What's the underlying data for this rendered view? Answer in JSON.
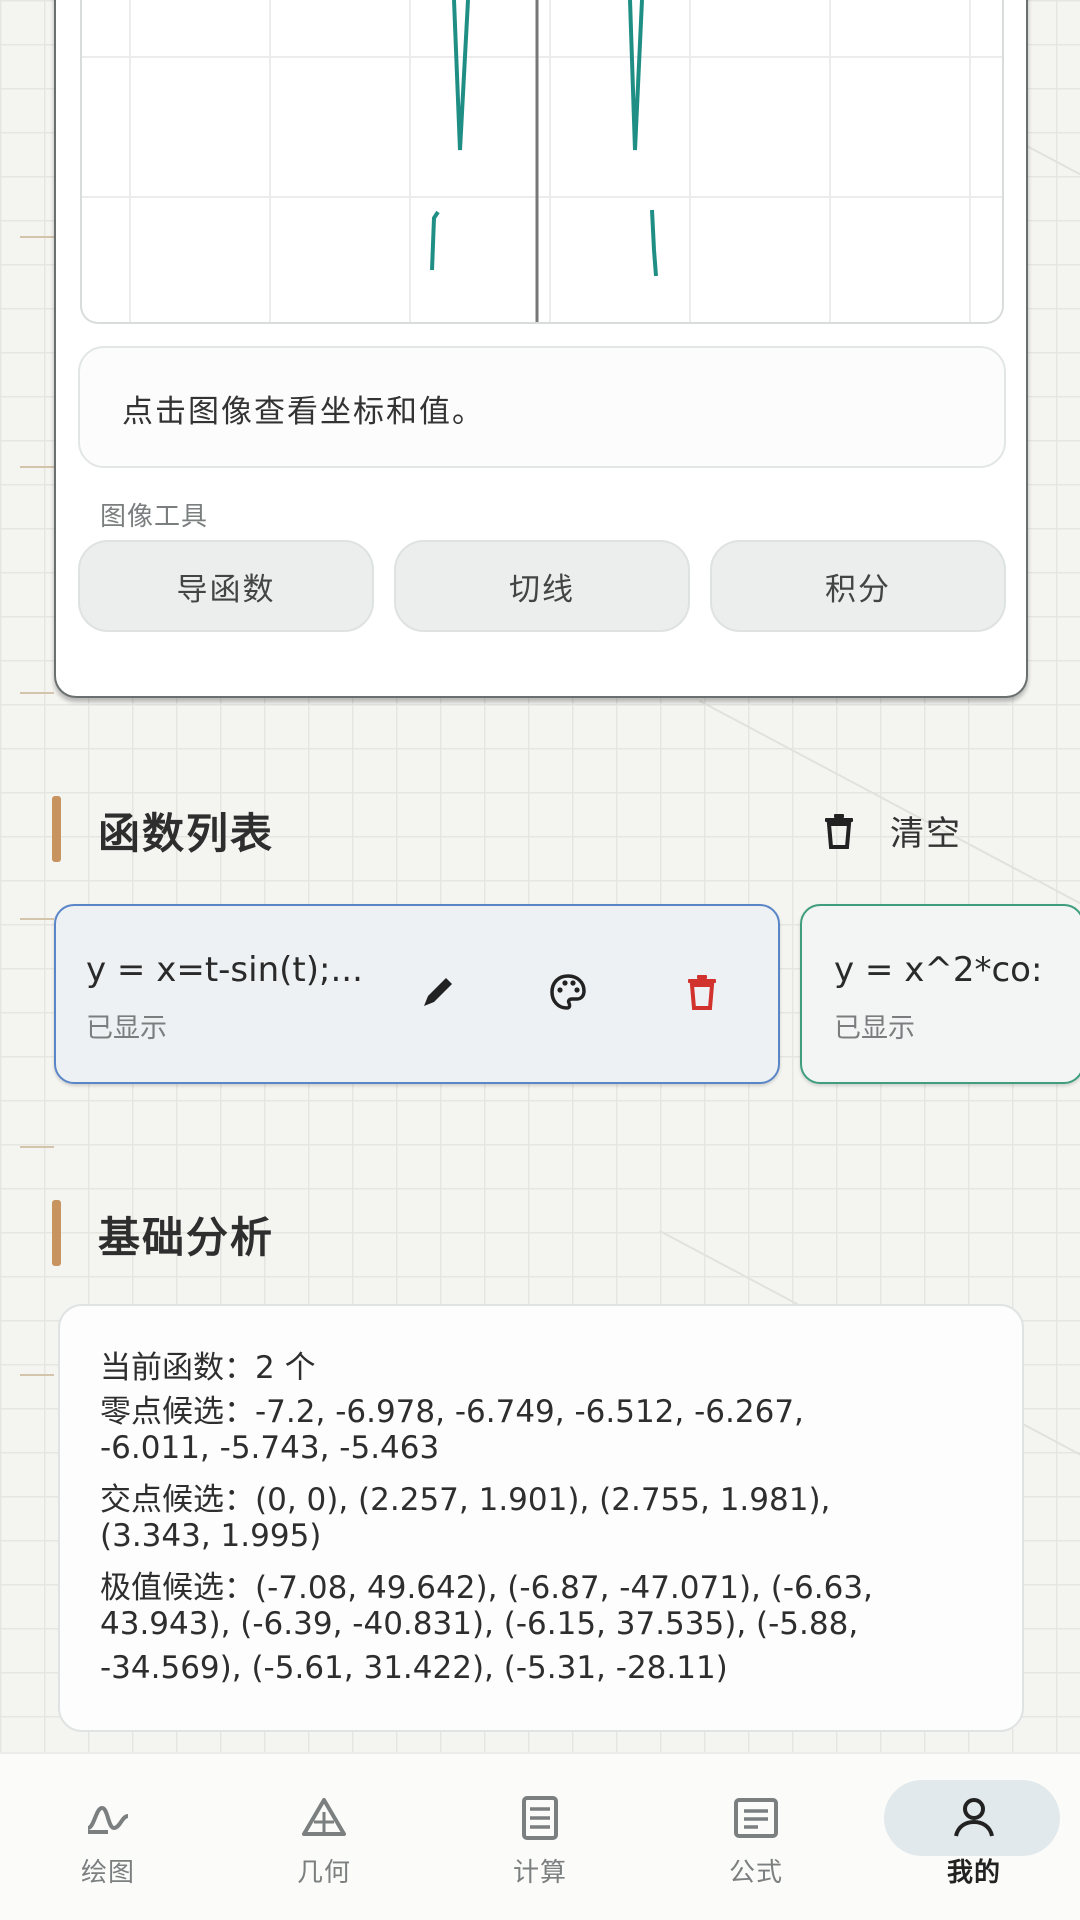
{
  "graph": {
    "hint": "点击图像查看坐标和值。",
    "tools_label": "图像工具",
    "tools": [
      {
        "label": "导函数",
        "icon": "derivative-button"
      },
      {
        "label": "切线",
        "icon": "tangent-button"
      },
      {
        "label": "积分",
        "icon": "integral-button"
      }
    ],
    "curve_color": "#1f8f86"
  },
  "function_list": {
    "title": "函数列表",
    "clear_label": "清空",
    "clear_icon": "trash-icon",
    "items": [
      {
        "formula": "y = x=t-sin(t);...",
        "status": "已显示",
        "border_color": "#5a86c8",
        "icons": [
          "pencil-icon",
          "palette-icon",
          "trash-icon"
        ]
      },
      {
        "formula": "y = x^2*co:",
        "status": "已显示",
        "border_color": "#3e9e7e"
      }
    ]
  },
  "analysis": {
    "title": "基础分析",
    "lines": [
      "当前函数：2 个",
      "零点候选：-7.2, -6.978, -6.749, -6.512, -6.267,",
      "-6.011, -5.743, -5.463",
      "交点候选：(0, 0), (2.257, 1.901), (2.755, 1.981),",
      "(3.343, 1.995)",
      "极值候选：(-7.08, 49.642), (-6.87, -47.071), (-6.63,",
      "43.943), (-6.39, -40.831), (-6.15, 37.535), (-5.88,",
      "-34.569), (-5.61, 31.422), (-5.31, -28.11)"
    ]
  },
  "nav": {
    "items": [
      {
        "label": "绘图",
        "icon": "graph-icon"
      },
      {
        "label": "几何",
        "icon": "geometry-icon"
      },
      {
        "label": "计算",
        "icon": "calculator-icon"
      },
      {
        "label": "公式",
        "icon": "formula-icon"
      },
      {
        "label": "我的",
        "icon": "person-icon"
      }
    ],
    "selected": "我的"
  },
  "colors": {
    "accent_bar": "#c7935f",
    "delete_red": "#d2322d",
    "active_card_border": "#5a86c8",
    "second_card_border": "#3e9e7e"
  }
}
